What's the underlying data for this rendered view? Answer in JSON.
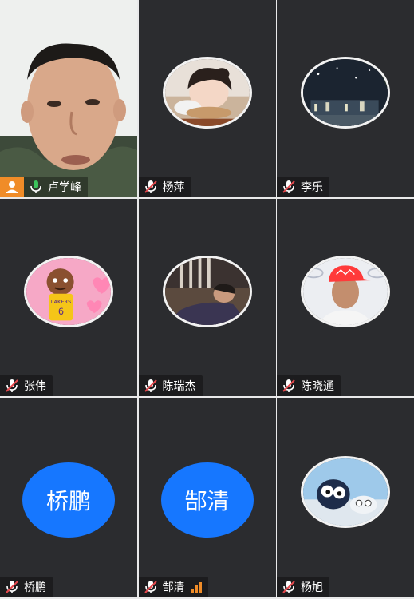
{
  "participants": [
    {
      "name": "卢学峰",
      "mic": "speaking",
      "host": true,
      "video": "camera"
    },
    {
      "name": "杨萍",
      "mic": "muted",
      "video": "avatar",
      "avatar_icon": "girl-photo"
    },
    {
      "name": "李乐",
      "mic": "muted",
      "video": "avatar",
      "avatar_icon": "night-city-photo"
    },
    {
      "name": "张伟",
      "mic": "muted",
      "video": "avatar",
      "avatar_icon": "cartoon-lakers-player"
    },
    {
      "name": "陈瑞杰",
      "mic": "muted",
      "video": "avatar",
      "avatar_icon": "sleeping-man-photo"
    },
    {
      "name": "陈晓通",
      "mic": "muted",
      "video": "avatar",
      "avatar_icon": "tennis-player-photo"
    },
    {
      "name": "桥鹏",
      "mic": "muted",
      "video": "text",
      "avatar_text": "桥鹏"
    },
    {
      "name": "郜清",
      "mic": "muted",
      "video": "text",
      "avatar_text": "郜清",
      "signal": "weak"
    },
    {
      "name": "杨旭",
      "mic": "muted",
      "video": "avatar",
      "avatar_icon": "toy-bird-photo"
    }
  ],
  "cartoon_jersey_text": "LAKERS",
  "cartoon_jersey_number": "6",
  "colors": {
    "tile_bg": "#2b2c2f",
    "active_border": "#3cc35b",
    "host_badge": "#f08c28",
    "text_avatar": "#1677ff",
    "mic_muted": "#e5484d"
  }
}
